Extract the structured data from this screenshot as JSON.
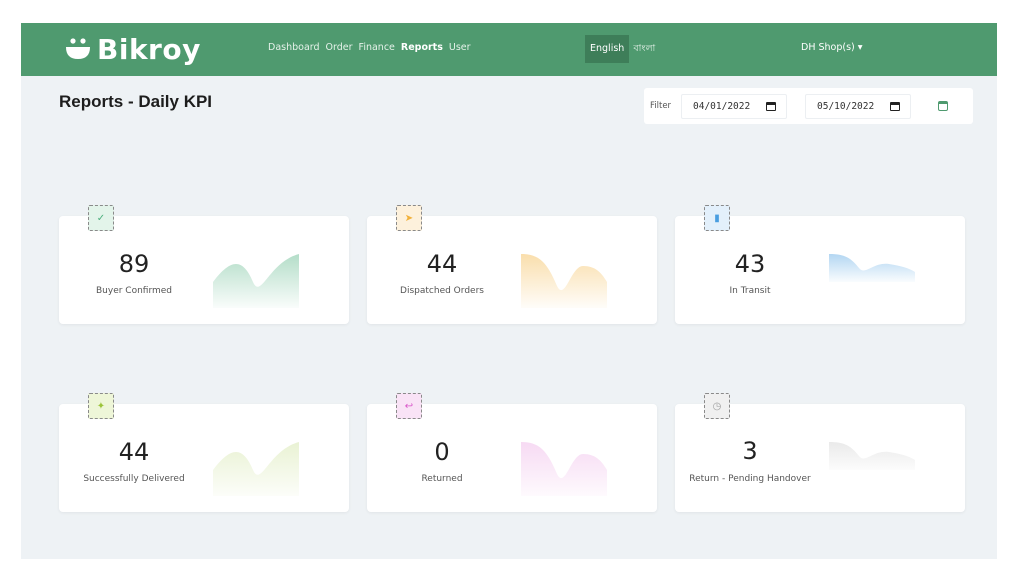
{
  "brand": {
    "name": "Bikroy"
  },
  "nav": {
    "items": [
      {
        "label": "Dashboard",
        "active": false
      },
      {
        "label": "Order",
        "active": false
      },
      {
        "label": "Finance",
        "active": false
      },
      {
        "label": "Reports",
        "active": true
      },
      {
        "label": "User",
        "active": false
      }
    ]
  },
  "language": {
    "options": [
      "English",
      "বাংলা"
    ],
    "selected": "English"
  },
  "shop_menu": {
    "label": "DH Shop(s) ▾"
  },
  "page": {
    "title": "Reports - Daily KPI"
  },
  "filter": {
    "label": "Filter",
    "from_date": "04/01/2022",
    "to_date": "05/10/2022"
  },
  "kpis": [
    {
      "value": "89",
      "label": "Buyer Confirmed",
      "icon": "check-icon",
      "icon_glyph": "✓",
      "color": "#4caf7d",
      "badge_bg": "#e3f4ea"
    },
    {
      "value": "44",
      "label": "Dispatched Orders",
      "icon": "send-icon",
      "icon_glyph": "➤",
      "color": "#f2b13a",
      "badge_bg": "#fdf1dc"
    },
    {
      "value": "43",
      "label": "In Transit",
      "icon": "truck-icon",
      "icon_glyph": "▮",
      "color": "#4a9ee0",
      "badge_bg": "#e3f0fb"
    },
    {
      "value": "44",
      "label": "Successfully Delivered",
      "icon": "delivered-icon",
      "icon_glyph": "✦",
      "color": "#9cc43a",
      "badge_bg": "#eef6d8"
    },
    {
      "value": "0",
      "label": "Returned",
      "icon": "return-icon",
      "icon_glyph": "↩",
      "color": "#d957c9",
      "badge_bg": "#f9e3f6"
    },
    {
      "value": "3",
      "label": "Return - Pending Handover",
      "icon": "clock-icon",
      "icon_glyph": "◷",
      "color": "#9e9e9e",
      "badge_bg": "#f0f0f0"
    }
  ],
  "colors": {
    "header": "#4f9a6f",
    "background": "#eef2f5"
  }
}
